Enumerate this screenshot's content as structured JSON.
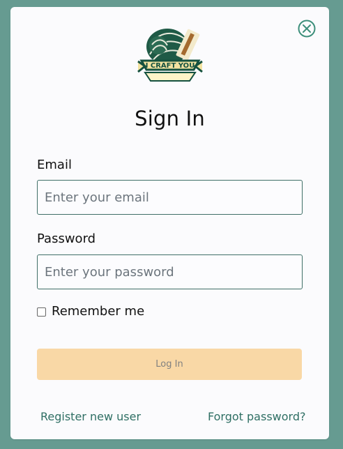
{
  "modal": {
    "title": "Sign In",
    "close_icon": "close-circle-icon",
    "logo": {
      "text": "I CRAFT YOU",
      "icon": "craft-logo"
    }
  },
  "form": {
    "email_label": "Email",
    "email_placeholder": "Enter your email",
    "password_label": "Password",
    "password_placeholder": "Enter your password",
    "remember_label": "Remember me",
    "login_button": "Log In"
  },
  "footer": {
    "register_link": "Register new user",
    "forgot_link": "Forgot password?"
  },
  "colors": {
    "page_background": "#669b91",
    "accent": "#2f6f64",
    "button_background": "#f9d8a6"
  }
}
